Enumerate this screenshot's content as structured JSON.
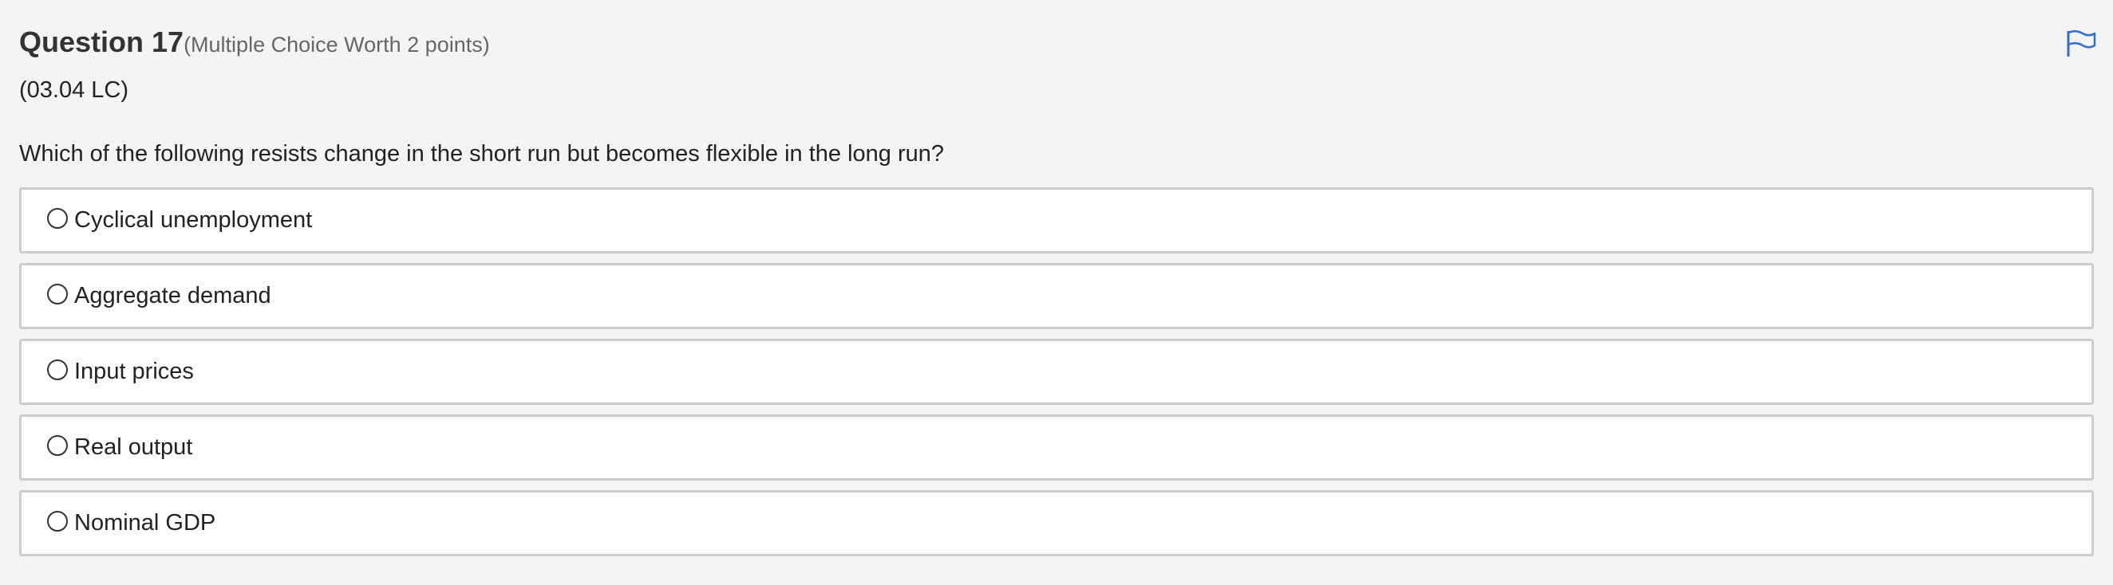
{
  "question": {
    "title": "Question 17",
    "type": "(Multiple Choice Worth 2 points)",
    "code": "(03.04 LC)",
    "prompt": "Which of the following resists change in the short run but becomes flexible in the long run?",
    "flag_icon": "flag-icon"
  },
  "choices": [
    {
      "label": "Cyclical unemployment",
      "selected": false
    },
    {
      "label": "Aggregate demand",
      "selected": false
    },
    {
      "label": "Input prices",
      "selected": false
    },
    {
      "label": "Real output",
      "selected": false
    },
    {
      "label": "Nominal GDP",
      "selected": false
    }
  ],
  "colors": {
    "background": "#f4f4f4",
    "card": "#ffffff",
    "border": "#cccccc",
    "flag": "#2e6fd9"
  }
}
